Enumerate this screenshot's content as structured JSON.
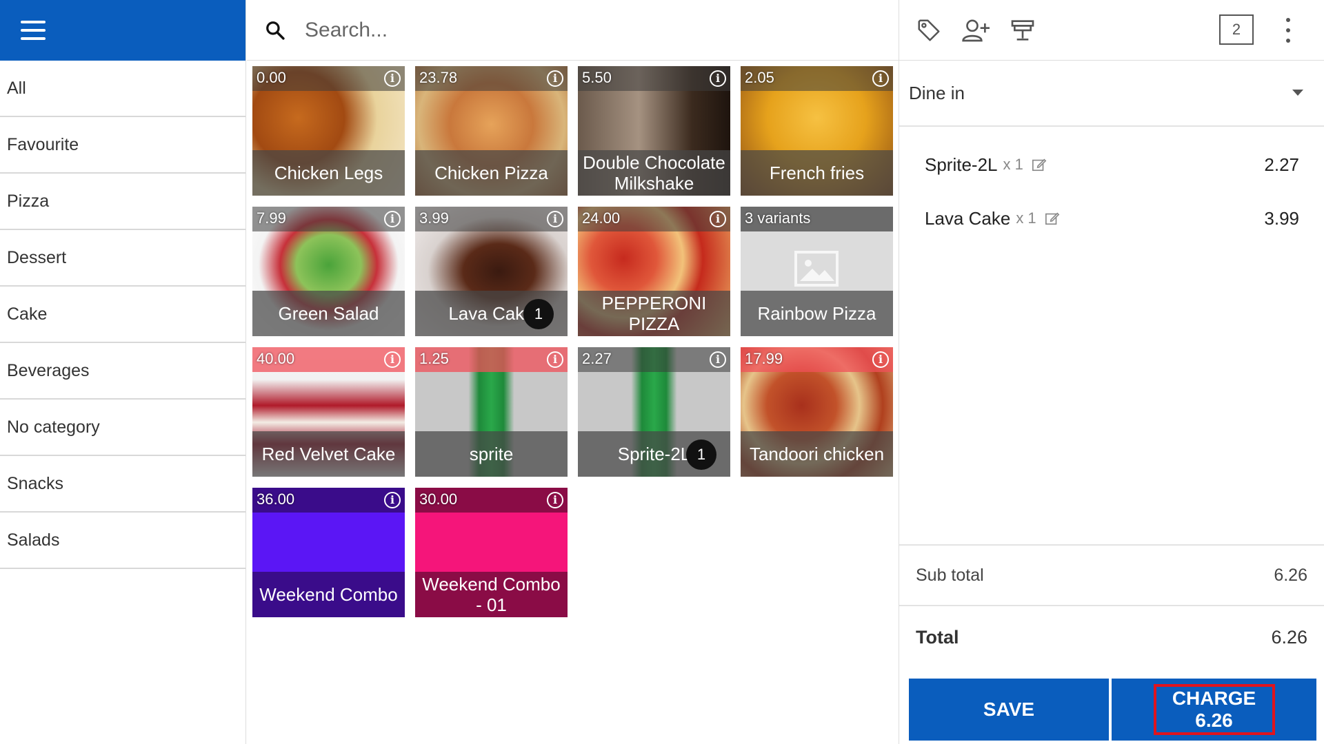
{
  "sidebar": {
    "categories": [
      "All",
      "Favourite",
      "Pizza",
      "Dessert",
      "Cake",
      "Beverages",
      "No category",
      "Snacks",
      "Salads"
    ]
  },
  "search": {
    "placeholder": "Search..."
  },
  "products": [
    {
      "price": "0.00",
      "name": "Chicken Legs",
      "icon": "chicken-legs-image"
    },
    {
      "price": "23.78",
      "name": "Chicken Pizza",
      "icon": "chicken-pizza-image"
    },
    {
      "price": "5.50",
      "name": "Double Chocolate Milkshake",
      "icon": "milkshake-image"
    },
    {
      "price": "2.05",
      "name": "French fries",
      "icon": "french-fries-image"
    },
    {
      "price": "7.99",
      "name": "Green Salad",
      "icon": "green-salad-image"
    },
    {
      "price": "3.99",
      "name": "Lava Cake",
      "icon": "lava-cake-image",
      "count": "1"
    },
    {
      "price": "24.00",
      "name": "PEPPERONI PIZZA",
      "icon": "pepperoni-pizza-image"
    },
    {
      "price": "3 variants",
      "name": "Rainbow Pizza",
      "icon": "image-placeholder-icon"
    },
    {
      "price": "40.00",
      "name": "Red Velvet Cake",
      "icon": "red-velvet-cake-image"
    },
    {
      "price": "1.25",
      "name": "sprite",
      "icon": "sprite-bottle-image"
    },
    {
      "price": "2.27",
      "name": "Sprite-2L",
      "icon": "sprite-bottle-image",
      "count": "1"
    },
    {
      "price": "17.99",
      "name": "Tandoori chicken",
      "icon": "tandoori-chicken-image"
    },
    {
      "price": "36.00",
      "name": "Weekend Combo",
      "icon": "color-tile",
      "color": "#5b16f5"
    },
    {
      "price": "30.00",
      "name": "Weekend Combo - 01",
      "icon": "color-tile",
      "color": "#f5157a"
    }
  ],
  "toolbar": {
    "icons": [
      "tag-icon",
      "add-customer-icon",
      "printer-icon"
    ],
    "ticket_count": "2"
  },
  "order": {
    "dining_option": "Dine in",
    "lines": [
      {
        "name": "Sprite-2L",
        "qty": "x 1",
        "amount": "2.27"
      },
      {
        "name": "Lava Cake",
        "qty": "x 1",
        "amount": "3.99"
      }
    ],
    "subtotal_label": "Sub total",
    "subtotal_value": "6.26",
    "total_label": "Total",
    "total_value": "6.26",
    "save_label": "SAVE",
    "charge_label": "CHARGE",
    "charge_amount": "6.26"
  },
  "colors": {
    "brand_blue": "#0a5dbd",
    "highlight_red": "#e0141e"
  }
}
